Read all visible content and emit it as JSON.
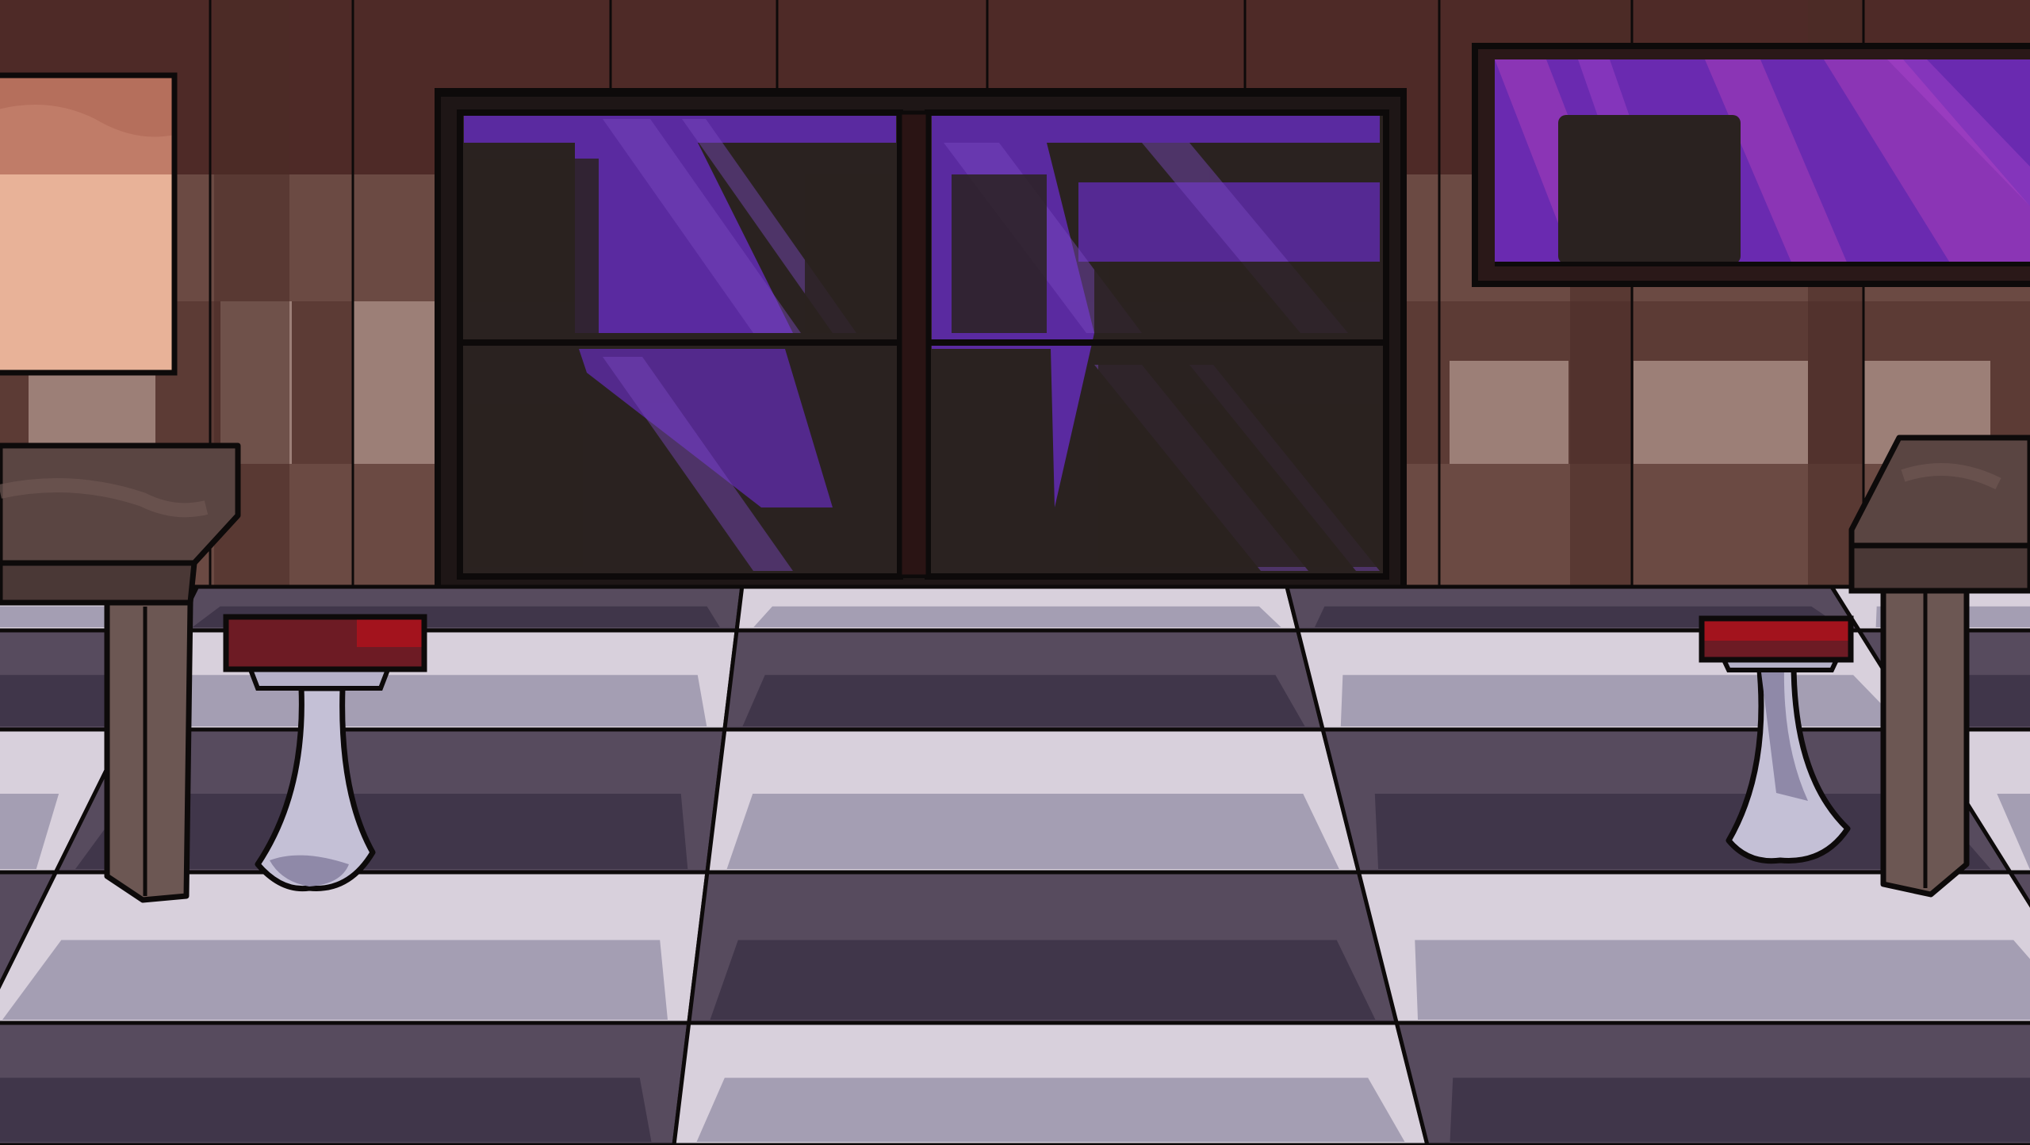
{
  "scene": {
    "name": "diner-interior-background",
    "visible_text": []
  },
  "palette": {
    "wall_top": "#4e2a27",
    "wall_mid": "#6b4a43",
    "wall_panel": "#5c3b35",
    "wall_panel_light": "#9c7f77",
    "outline": "#0d0a0a",
    "floor_light": "#d8d0dc",
    "floor_light_shade": "#9b95ab",
    "floor_dark": "#574b5e",
    "floor_dark_shade": "#3c3346",
    "glass_dark": "#2a2220",
    "glass_purple": "#5a2aa0",
    "glass_purple_light": "#7a4ac0",
    "window_magenta": "#9a3ab8",
    "door_frame": "#1e1616",
    "table_top": "#5a4542",
    "table_leg": "#6c5753",
    "stool_seat": "#a3131d",
    "stool_seat_shade": "#6d1b24",
    "stool_base": "#c4c0d6",
    "stool_base_shade": "#8f89a8",
    "poster_top": "#b56f5c",
    "poster_bottom": "#e8b298"
  },
  "objects": [
    {
      "name": "wall-poster",
      "icon": "poster-frame"
    },
    {
      "name": "double-glass-doors",
      "icon": "door"
    },
    {
      "name": "purple-window",
      "icon": "window"
    },
    {
      "name": "left-table",
      "icon": "table"
    },
    {
      "name": "right-table",
      "icon": "table"
    },
    {
      "name": "left-bar-stool",
      "icon": "stool"
    },
    {
      "name": "right-bar-stool",
      "icon": "stool"
    },
    {
      "name": "checkered-floor",
      "icon": "floor-tiles"
    }
  ]
}
